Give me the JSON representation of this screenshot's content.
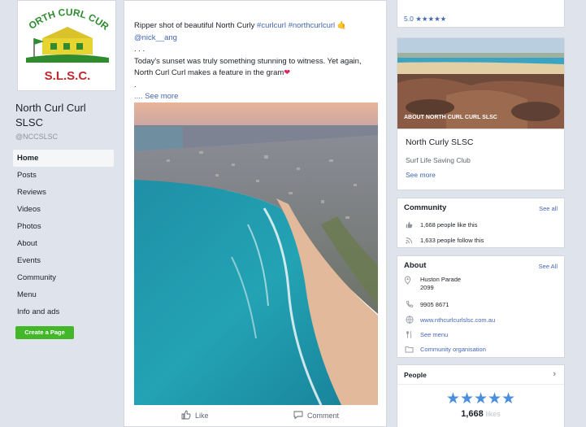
{
  "left": {
    "logo": {
      "line1": "NORTH CURL CURL",
      "line2": "S.L.S.C."
    },
    "page_name": "North Curl Curl SLSC",
    "handle": "@NCCSLSC",
    "nav": [
      "Home",
      "Posts",
      "Reviews",
      "Videos",
      "Photos",
      "About",
      "Events",
      "Community",
      "Menu",
      "Info and ads"
    ],
    "create_page": "Create a Page"
  },
  "post": {
    "line1_pre": "Ripper shot of beautiful North Curly ",
    "hashtags": "#curlcurl #northcurlcurl",
    "line1_emoji": "🤙",
    "handle": "@nick__ang",
    "dots": ". . .",
    "line3": "Today's sunset was truly something stunning to witness. Yet again, North Curl Curl makes a feature in the gram",
    "heart": "❤",
    "dot": ".",
    "see_more": ".... See more",
    "like": "Like",
    "comment": "Comment"
  },
  "right": {
    "rating": "5.0",
    "rating_stars": "★★★★★",
    "cover_label": "ABOUT NORTH CURL CURL SLSC",
    "about_name": "North Curly SLSC",
    "about_category": "Surf Life Saving Club",
    "about_see_more": "See more",
    "community": {
      "title": "Community",
      "see_all": "See all",
      "likes": "1,668 people like this",
      "follows": "1,633 people follow this"
    },
    "about": {
      "title": "About",
      "see_all": "See All",
      "address_line1": "Huston Parade",
      "address_line2": "2099",
      "phone": "9905 8671",
      "website": "www.nthcurlcurlslsc.com.au",
      "menu": "See menu",
      "category": "Community organisation"
    },
    "people": {
      "title": "People",
      "stars": "★★★★★",
      "likes_num": "1,668",
      "likes_word": "likes"
    }
  },
  "colors": {
    "accent": "#4267b2",
    "green": "#42b72a",
    "star": "#4a8fdd"
  }
}
